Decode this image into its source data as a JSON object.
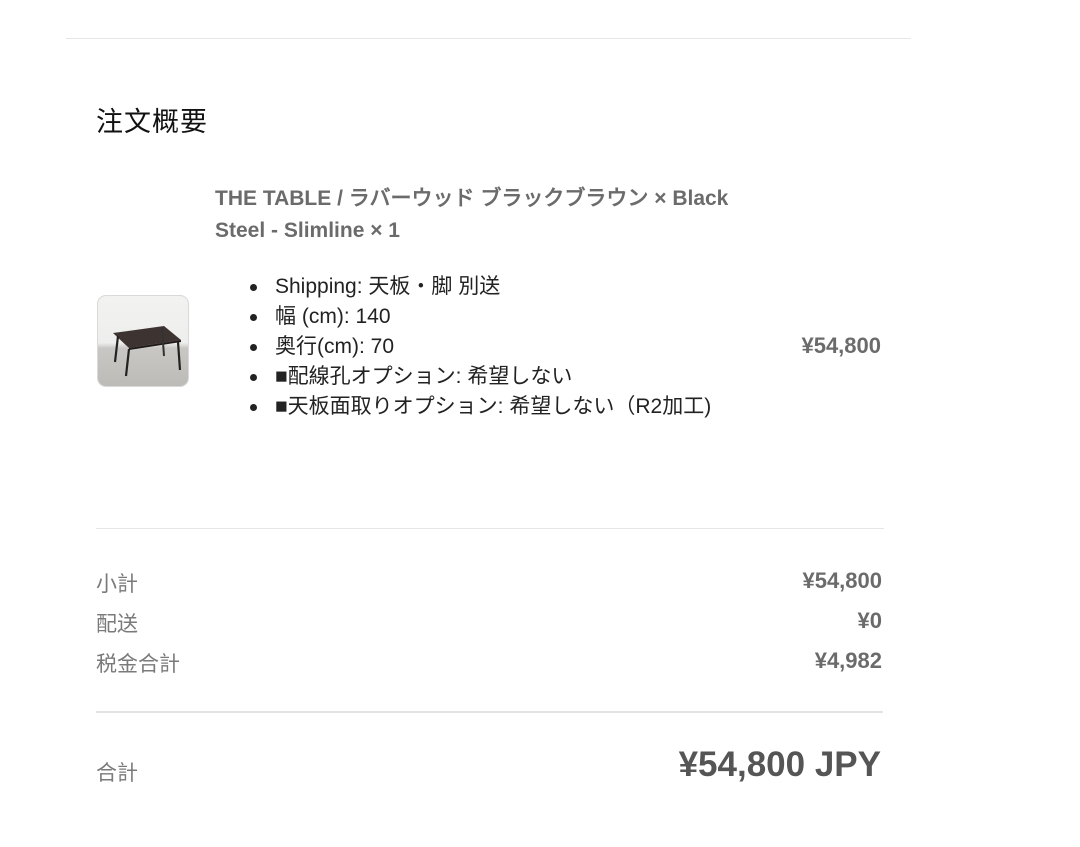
{
  "summary": {
    "title": "注文概要"
  },
  "line_item": {
    "title": "THE TABLE / ラバーウッド ブラックブラウン × Black Steel - Slimline × 1",
    "image_icon": "table-product-thumbnail",
    "options": [
      "Shipping: 天板・脚 別送",
      "幅 (cm): 140",
      "奥行(cm): 70",
      "■配線孔オプション: 希望しない",
      "■天板面取りオプション: 希望しない（R2加工)"
    ],
    "price": "¥54,800"
  },
  "totals": {
    "subtotal_label": "小計",
    "subtotal_value": "¥54,800",
    "shipping_label": "配送",
    "shipping_value": "¥0",
    "tax_label": "税金合計",
    "tax_value": "¥4,982",
    "total_label": "合計",
    "total_value": "¥54,800 JPY"
  }
}
